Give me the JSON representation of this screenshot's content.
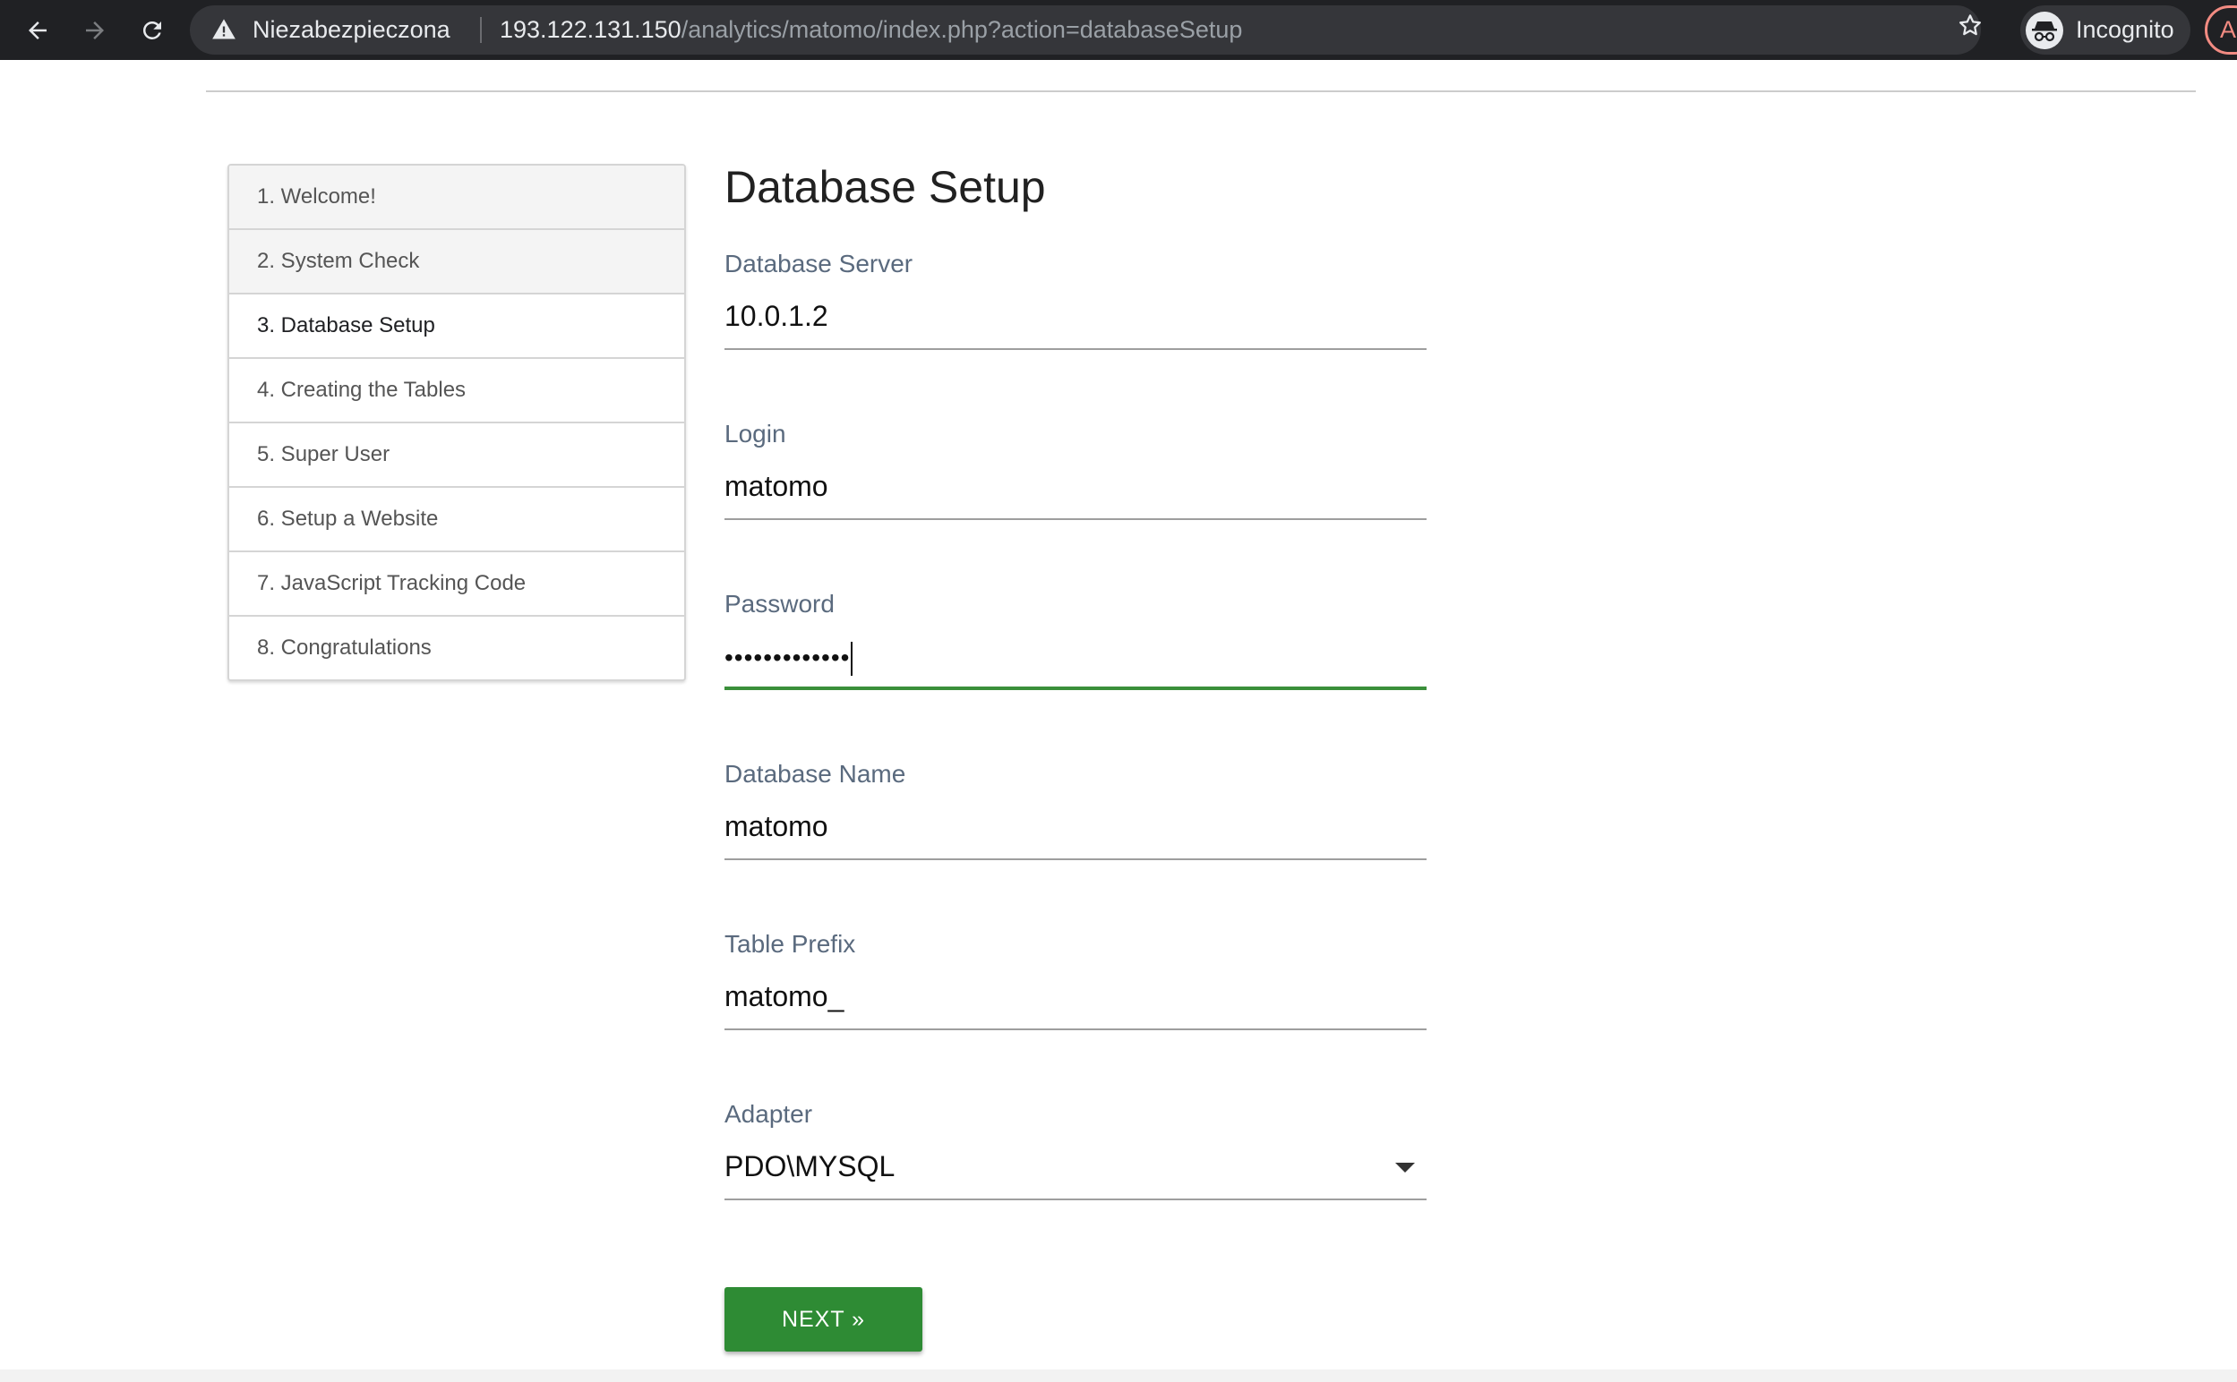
{
  "browser": {
    "security_label": "Niezabezpieczona",
    "url_host": "193.122.131.150",
    "url_path": "/analytics/matomo/index.php?action=databaseSetup",
    "incognito_label": "Incognito",
    "profile_initial": "A"
  },
  "steps": [
    {
      "label": "1. Welcome!",
      "state": "done"
    },
    {
      "label": "2. System Check",
      "state": "done"
    },
    {
      "label": "3. Database Setup",
      "state": "current"
    },
    {
      "label": "4. Creating the Tables",
      "state": "todo"
    },
    {
      "label": "5. Super User",
      "state": "todo"
    },
    {
      "label": "6. Setup a Website",
      "state": "todo"
    },
    {
      "label": "7. JavaScript Tracking Code",
      "state": "todo"
    },
    {
      "label": "8. Congratulations",
      "state": "todo"
    }
  ],
  "form": {
    "title": "Database Setup",
    "db_server": {
      "label": "Database Server",
      "value": "10.0.1.2"
    },
    "login": {
      "label": "Login",
      "value": "matomo"
    },
    "password": {
      "label": "Password",
      "masked_value": "•••••••••••••"
    },
    "db_name": {
      "label": "Database Name",
      "value": "matomo"
    },
    "table_prefix": {
      "label": "Table Prefix",
      "value": "matomo_"
    },
    "adapter": {
      "label": "Adapter",
      "value": "PDO\\MYSQL"
    },
    "next_label": "NEXT »"
  },
  "colors": {
    "accent_green": "#2e8b34",
    "focus_underline": "#3a8f3a",
    "chrome_bg": "#202124"
  },
  "icons": [
    "back-arrow-icon",
    "forward-arrow-icon",
    "reload-icon",
    "warning-triangle-icon",
    "star-icon",
    "incognito-icon",
    "dropdown-arrow-icon"
  ]
}
